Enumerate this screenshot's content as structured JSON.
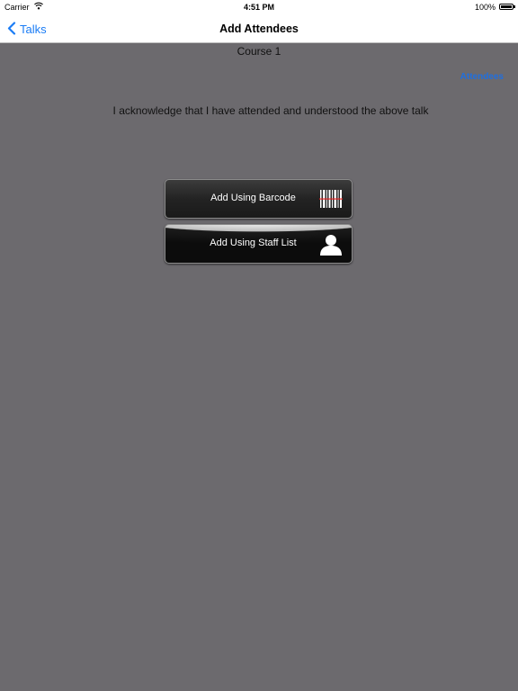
{
  "status_bar": {
    "carrier": "Carrier",
    "time": "4:51 PM",
    "battery": "100%"
  },
  "nav": {
    "back_label": "Talks",
    "title": "Add Attendees"
  },
  "content": {
    "course": "Course 1",
    "attendees_link": "Attendees",
    "acknowledgement": "I acknowledge that I have attended and understood the above talk"
  },
  "buttons": {
    "barcode": "Add Using Barcode",
    "staff_list": "Add Using Staff List"
  },
  "colors": {
    "background": "#6c6a6e",
    "accent": "#1a7cf5",
    "button": "#111111"
  }
}
